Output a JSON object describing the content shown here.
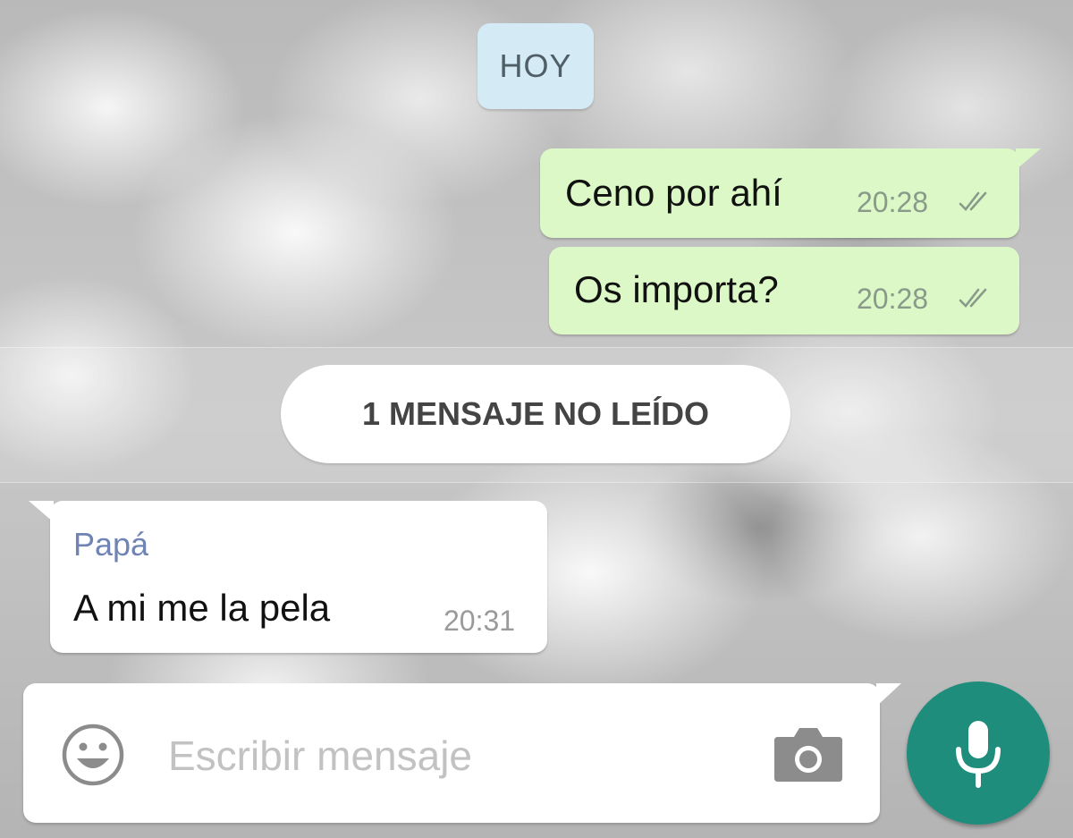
{
  "date_chip": {
    "label": "HOY"
  },
  "outgoing_messages": [
    {
      "text": "Ceno por ahí",
      "time": "20:28",
      "status": "double-check-icon"
    },
    {
      "text": "Os importa?",
      "time": "20:28",
      "status": "double-check-icon"
    }
  ],
  "unread_banner": {
    "label": "1 MENSAJE NO LEÍDO"
  },
  "incoming_messages": [
    {
      "sender": "Papá",
      "text": "A mi me la pela",
      "time": "20:31"
    }
  ],
  "composer": {
    "placeholder": "Escribir mensaje",
    "value": "",
    "emoji_icon": "smiley-icon",
    "camera_icon": "camera-icon",
    "send_icon": "microphone-icon"
  },
  "colors": {
    "outgoing_bubble": "#dcf8c6",
    "incoming_bubble": "#ffffff",
    "date_chip": "#d4eaf4",
    "sender_name": "#6f84b5",
    "mic_button": "#1e8d7c"
  }
}
